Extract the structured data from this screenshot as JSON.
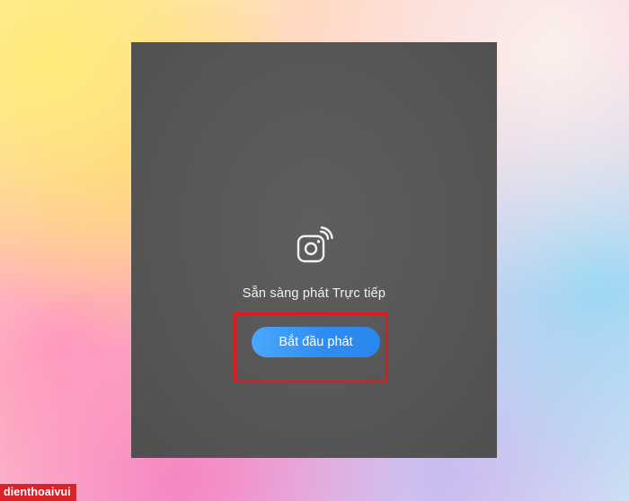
{
  "live_screen": {
    "icon": "live-camera-broadcast-icon",
    "status_text": "Sẵn sàng phát Trực tiếp",
    "start_button_label": "Bắt đầu phát"
  },
  "annotation": {
    "highlight_color": "#e0181f"
  },
  "watermark": {
    "text": "dienthoaivui"
  },
  "colors": {
    "screen_background": "#565656",
    "button_blue": "#2f8df2",
    "text": "#f2f2f2"
  }
}
